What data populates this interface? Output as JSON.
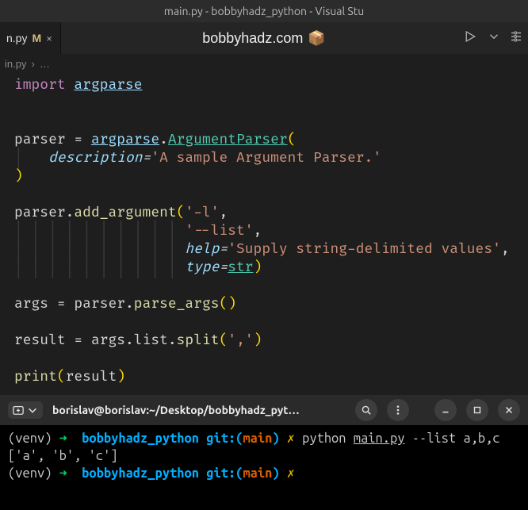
{
  "window": {
    "title": "main.py - bobbyhadz_python - Visual Stu"
  },
  "tab": {
    "name": "n.py",
    "dirty_marker": "M",
    "close_glyph": "×"
  },
  "center": {
    "label": "bobbyhadz.com",
    "emoji": "📦"
  },
  "breadcrumb": {
    "file": "in.py",
    "sep": "›",
    "rest": "…"
  },
  "code": {
    "l1_import": "import",
    "l1_mod": "argparse",
    "l3_var": "parser",
    "l3_eq": " = ",
    "l3_mod": "argparse",
    "l3_dot": ".",
    "l3_cls": "ArgumentParser",
    "l3_lp": "(",
    "l4_indent": "    ",
    "l4_param": "description",
    "l4_eq": "=",
    "l4_str": "'A sample Argument Parser.'",
    "l5_rp": ")",
    "l7_var": "parser",
    "l7_dot": ".",
    "l7_meth": "add_argument",
    "l7_lp": "(",
    "l7_arg1": "'-l'",
    "l7_comma": ",",
    "l8_indent": "                    ",
    "l8_arg": "'--list'",
    "l8_comma": ",",
    "l9_indent": "                    ",
    "l9_param": "help",
    "l9_eq": "=",
    "l9_str": "'Supply string-delimited values'",
    "l9_comma": ",",
    "l10_indent": "                    ",
    "l10_param": "type",
    "l10_eq": "=",
    "l10_val": "str",
    "l10_rp": ")",
    "l12_var": "args",
    "l12_eq": " = ",
    "l12_p": "parser",
    "l12_dot": ".",
    "l12_m": "parse_args",
    "l12_lp": "(",
    "l12_rp": ")",
    "l14_var": "result",
    "l14_eq": " = ",
    "l14_a": "args",
    "l14_d1": ".",
    "l14_l": "list",
    "l14_d2": ".",
    "l14_m": "split",
    "l14_lp": "(",
    "l14_str": "','",
    "l14_rp": ")",
    "l16_fn": "print",
    "l16_lp": "(",
    "l16_arg": "result",
    "l16_rp": ")"
  },
  "terminal": {
    "title": "borislav@borislav:~/Desktop/bobbyhadz_pyt…",
    "line1": {
      "venv": "(venv)",
      "arrow": "➜",
      "dir": "bobbyhadz_python",
      "git": "git:",
      "lp": "(",
      "branch": "main",
      "rp": ")",
      "dirty": "✗",
      "cmd_prefix": "python ",
      "cmd_file": "main.py",
      "cmd_args": " --list a,b,c"
    },
    "output": "['a', 'b', 'c']",
    "line2": {
      "venv": "(venv)",
      "arrow": "➜",
      "dir": "bobbyhadz_python",
      "git": "git:",
      "lp": "(",
      "branch": "main",
      "rp": ")",
      "dirty": "✗"
    }
  }
}
